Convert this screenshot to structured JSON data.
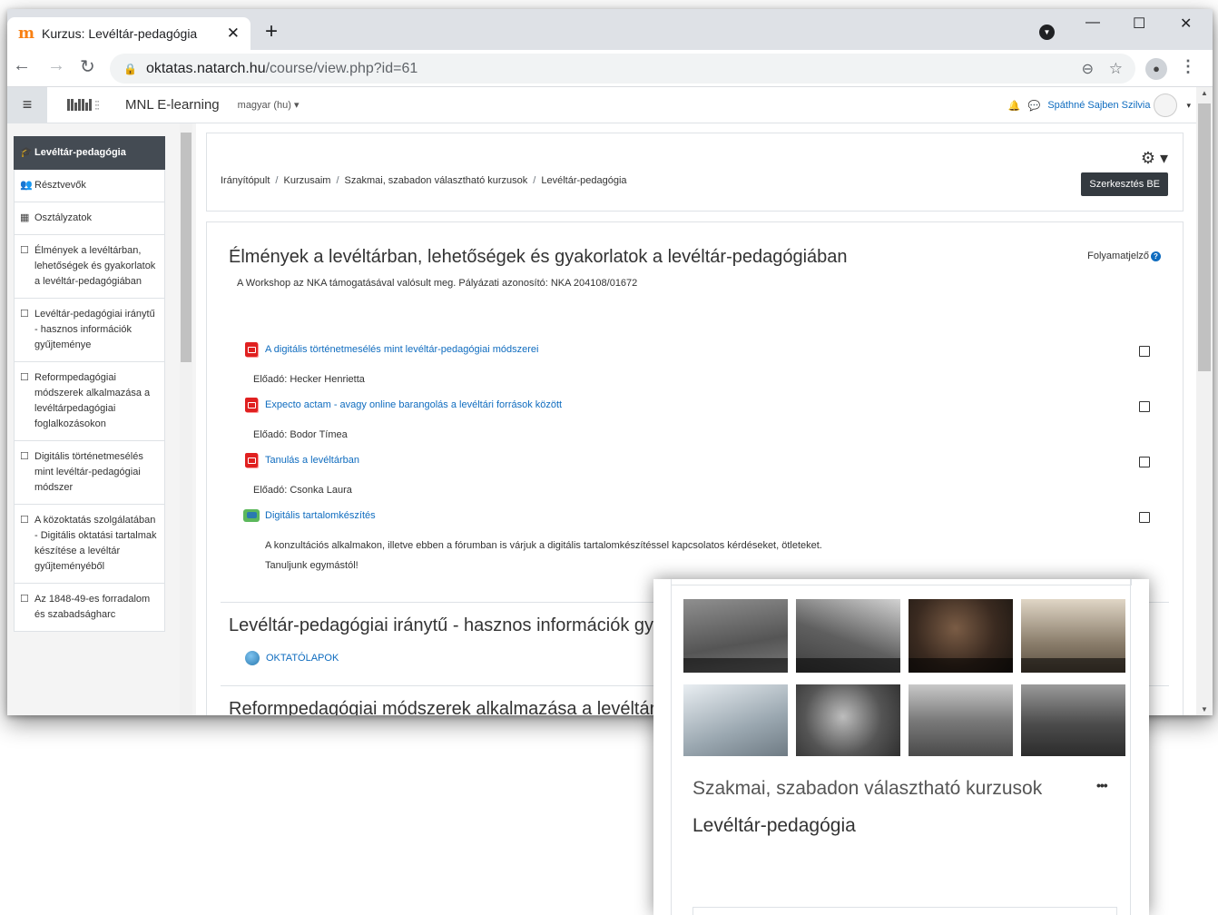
{
  "browser": {
    "tab_title": "Kurzus: Levéltár-pedagógia",
    "tab_close": "✕",
    "new_tab": "+",
    "url_host": "oktatas.natarch.hu",
    "url_path": "/course/view.php?id=61",
    "win_min": "—",
    "win_max": "☐",
    "win_close": "✕"
  },
  "header": {
    "site_name": "MNL E-learning",
    "language": "magyar (hu) ▾",
    "user_name": "Spáthné Sajben Szilvia",
    "caret": "▾"
  },
  "drawer": {
    "items": [
      {
        "icon": "🎓",
        "label": "Levéltár-pedagógia"
      },
      {
        "icon": "👥",
        "label": "Résztvevők"
      },
      {
        "icon": "▦",
        "label": "Osztályzatok"
      },
      {
        "icon": "☐",
        "label": "Élmények a levéltárban, lehetőségek és gyakorlatok a levéltár-pedagógiában"
      },
      {
        "icon": "☐",
        "label": "Levéltár-pedagógiai iránytű - hasznos információk gyűjteménye"
      },
      {
        "icon": "☐",
        "label": "Reformpedagógiai módszerek alkalmazása a levéltárpedagógiai foglalkozásokon"
      },
      {
        "icon": "☐",
        "label": "Digitális történetmesélés mint levéltár-pedagógiai módszer"
      },
      {
        "icon": "☐",
        "label": "A közoktatás szolgálatában - Digitális oktatási tartalmak készítése a levéltár gyűjteményéből"
      },
      {
        "icon": "☐",
        "label": "Az 1848-49-es forradalom és szabadságharc"
      }
    ]
  },
  "breadcrumb": {
    "items": [
      "Irányítópult",
      "Kurzusaim",
      "Szakmai, szabadon választható kurzusok",
      "Levéltár-pedagógia"
    ],
    "separator": "/"
  },
  "page_header": {
    "edit_button": "Szerkesztés BE",
    "gear": "⚙ ▾"
  },
  "section1": {
    "title": "Élmények a levéltárban, lehetőségek és gyakorlatok a levéltár-pedagógiában",
    "summary": "A Workshop az NKA támogatásával valósult meg. Pályázati azonosító: NKA 204108/01672",
    "progress_label": "Folyamatjelző",
    "progress_help": "?",
    "activities": [
      {
        "name": "A digitális történetmesélés mint levéltár-pedagógiai módszerei",
        "presenter": "Előadó: Hecker Henrietta"
      },
      {
        "name": "Expecto actam - avagy online barangolás a levéltári források között",
        "presenter": "Előadó: Bodor Tímea"
      },
      {
        "name": "Tanulás a levéltárban",
        "presenter": "Előadó: Csonka Laura"
      }
    ],
    "forum": {
      "name": "Digitális tartalomkészítés",
      "text1": "A konzultációs alkalmakon, illetve ebben a fórumban is várjuk a digitális tartalomkészítéssel kapcsolatos kérdéseket, ötleteket.",
      "text2": "Tanuljunk egymástól!"
    }
  },
  "section2": {
    "title": "Levéltár-pedagógiai iránytű - hasznos információk gyűjteménye",
    "link": "OKTATÓLAPOK"
  },
  "section3": {
    "title": "Reformpedagógiai módszerek alkalmazása a levéltárpedagógiai foglalkozásokon"
  },
  "card": {
    "category": "Szakmai, szabadon választható kurzusok",
    "course_name": "Levéltár-pedagógia",
    "more": "•••"
  }
}
